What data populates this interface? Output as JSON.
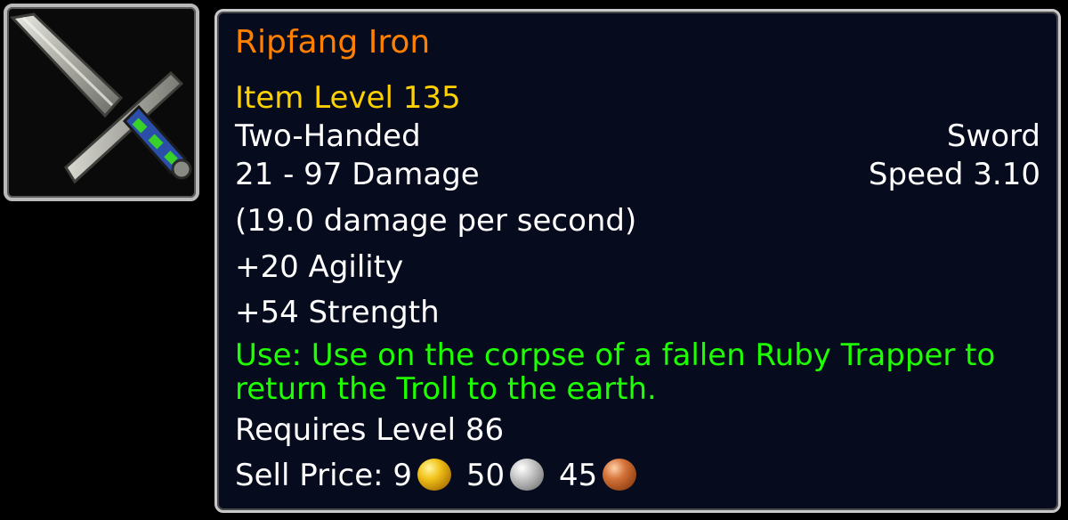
{
  "item": {
    "name": "Ripfang Iron",
    "name_color": "#ff8000",
    "item_level": "Item Level 135",
    "slot": "Two-Handed",
    "weapon_type": "Sword",
    "damage": "21 - 97 Damage",
    "speed": "Speed 3.10",
    "dps": "(19.0 damage per second)",
    "stats": [
      "+20 Agility",
      "+54 Strength"
    ],
    "use_effect": "Use: Use on the corpse of a fallen Ruby Trapper to return the Troll to the earth.",
    "use_color": "#1eff00",
    "requires": "Requires Level 86",
    "sell_label": "Sell Price:",
    "sell_price": {
      "gold": "9",
      "silver": "50",
      "copper": "45"
    },
    "icon": "sword-icon"
  }
}
